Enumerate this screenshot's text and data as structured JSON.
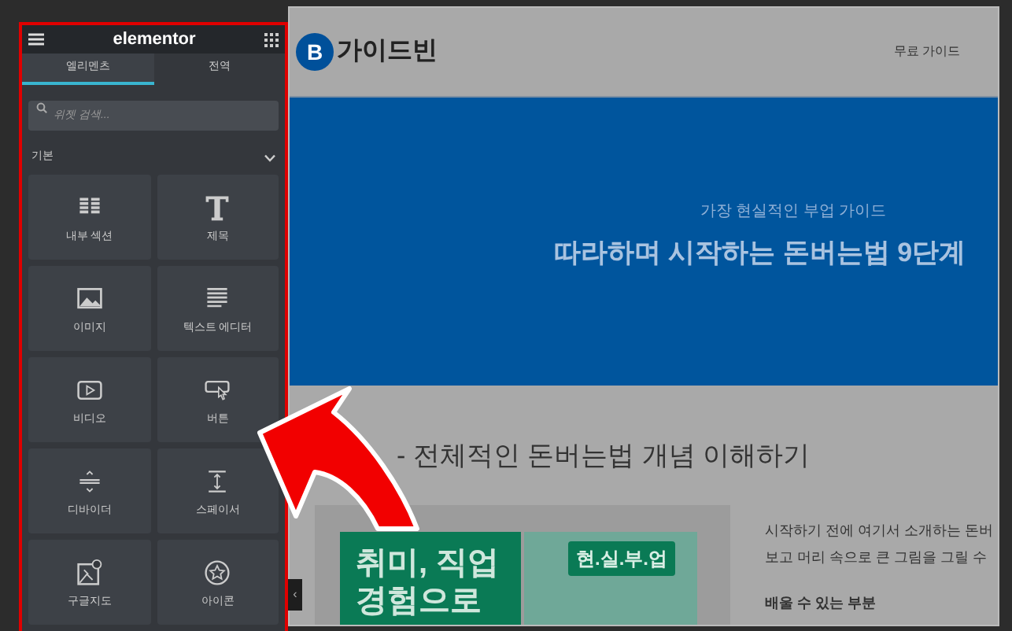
{
  "panel": {
    "logo": "elementor",
    "tabs": [
      {
        "label": "엘리멘츠",
        "selected": true
      },
      {
        "label": "전역",
        "selected": false
      }
    ],
    "search": {
      "placeholder": "위젯 검색..."
    },
    "category": {
      "label": "기본",
      "expanded": true
    },
    "widgets": [
      {
        "label": "내부 섹션",
        "kind": "columns"
      },
      {
        "label": "제목",
        "kind": "heading"
      },
      {
        "label": "이미지",
        "kind": "image"
      },
      {
        "label": "텍스트 에디터",
        "kind": "text"
      },
      {
        "label": "비디오",
        "kind": "video"
      },
      {
        "label": "버튼",
        "kind": "button"
      },
      {
        "label": "디바이더",
        "kind": "divider"
      },
      {
        "label": "스페이서",
        "kind": "spacer"
      },
      {
        "label": "구글지도",
        "kind": "map"
      },
      {
        "label": "아이콘",
        "kind": "star"
      }
    ],
    "collapse": "‹"
  },
  "site": {
    "logo_letter": "B",
    "logo_text": "가이드빈",
    "nav": [
      "무료 가이드"
    ],
    "hero": {
      "subtitle": "가장 현실적인 부업 가이드",
      "title": "따라하며 시작하는 돈버는법 9단계"
    },
    "section_title": "- 전체적인 돈버는법 개념 이해하기",
    "thumbnail": {
      "headline": "취미, 직업 경험으로",
      "badge": "현.실.부.업"
    },
    "intro": [
      "시작하기 전에 여기서 소개하는 돈버",
      "보고 머리 속으로 큰 그림을 그릴 수"
    ],
    "subheading": "배울 수 있는 부분"
  }
}
